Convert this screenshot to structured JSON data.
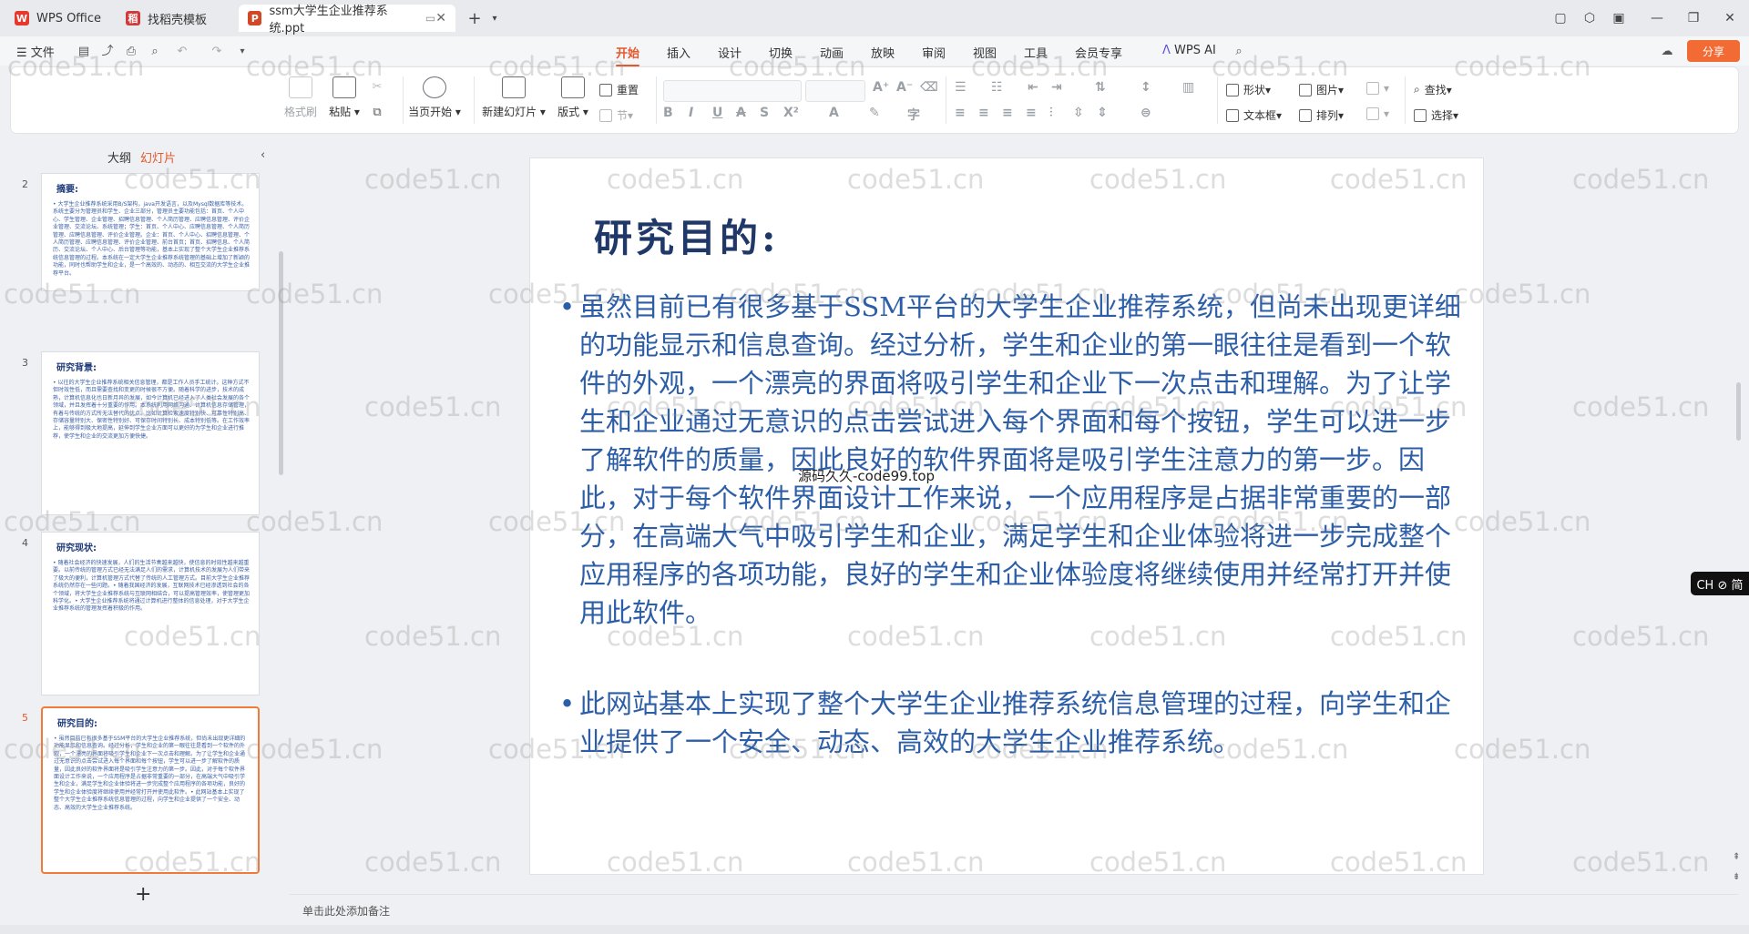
{
  "tabs": [
    {
      "label": "WPS Office",
      "icon": "wps-logo-icon",
      "color": "#e8372c"
    },
    {
      "label": "找稻壳模板",
      "icon": "docer-icon",
      "color": "#d13a3a"
    },
    {
      "label": "ssm大学生企业推荐系统.ppt",
      "icon": "ppt-icon",
      "color": "#d24726"
    }
  ],
  "menu": {
    "file": "文件",
    "ribbon_tabs": [
      "开始",
      "插入",
      "设计",
      "切换",
      "动画",
      "放映",
      "审阅",
      "视图",
      "工具",
      "会员专享"
    ],
    "active_tab": "开始",
    "wps_ai": "WPS AI",
    "share": "分享"
  },
  "ribbon": {
    "format_painter": "格式刷",
    "paste": "粘贴",
    "play_from_current": "当页开始",
    "new_slide": "新建幻灯片",
    "layout": "版式",
    "reset": "重置",
    "section": "节",
    "shape": "形状",
    "picture": "图片",
    "textbox": "文本框",
    "arrange": "排列",
    "find": "查找",
    "select": "选择"
  },
  "pane": {
    "outline_tab": "大纲",
    "slides_tab": "幻灯片",
    "active": "幻灯片"
  },
  "thumbnails": [
    {
      "num": "2",
      "title": "摘要:",
      "body": "• 大学生企业推荐系统采用B/S架构，java开发语言，以及Mysql数据库等技术。系统主要分为管理员和学生、企业三部分，管理员主要功能包括：首页、个人中心、学生管理、企业管理、招聘信息管理、个人简历管理、应聘信息管理、评价企业管理、交流论坛、系统管理；学生：首页、个人中心、应聘信息管理、个人简历管理、应聘信息管理、评价企业管理。企业：首页、个人中心、招聘信息管理、个人简历管理、应聘信息管理、评价企业管理、前台首页；首页、招聘信息、个人简历、交流论坛、个人中心、后台管理等功能，基本上实现了整个大学生企业推荐系统信息管理的过程。本系统在一定大学生企业推荐系统管理的基础上增加了新颖的功能，同时也帮助学生和企业，是一个高效的、动态的、相互交流的大学生企业推荐平台。"
    },
    {
      "num": "3",
      "title": "研究背景:",
      "body": "• 以往的大学生企业推荐系统相关信息管理，都是工作人员手工统计。这种方式不但时效性低，而且需要查找和变更的时候很不方便。随着科学的进步，技术的成熟，计算机信息化也日新月异的发展，如今计算机已经进入了人类社会发展的各个领域，并且发挥着十分重要的作用。本系统利用网络沟通、计算机信息存储管理，有着与传统的方式所无法替代的优点。比如计算检索速度特别快、可靠性特别高、存储容量特别大、保密性特别好、可保存时间特别长、成本特别低等。在工作效率上，能够得到极大地提高，延伸到学生企业方面可以更好的为学生和企业进行推荐，使学生和企业的交流更加方便快捷。"
    },
    {
      "num": "4",
      "title": "研究现状:",
      "body": "• 随着社会经济的快速发展，人们的生活节奏越来越快，使信息的时效性越来越重要。以前传统的管理方式已经无法满足人们的需求，计算机技术的发展为人们带来了极大的便利，计算机管理方式代替了传统的人工管理方式。目前大学生企业推荐系统仍然存在一些问题。• 随着我国经济的发展，互联网技术已经渗透到社会的各个领域，将大学生企业推荐系统与互联网相结合，可以提高管理效率，使管理更加科学化。• 大学生企业推荐系统将通过计算机进行整体的信息处理，对于大学生企业推荐系统的管理发挥着积极的作用。"
    },
    {
      "num": "5",
      "title": "研究目的:",
      "body": "• 虽然目前已有很多基于SSM平台的大学生企业推荐系统，但尚未出现更详细的功能显示和信息查询。经过分析，学生和企业的第一眼往往是看到一个软件的外观，一个漂亮的界面将吸引学生和企业下一次点击和理解。为了让学生和企业通过无意识的点击尝试进入每个界面和每个按钮，学生可以进一步了解软件的质量，因此良好的软件界面将是吸引学生注意力的第一步。因此，对于每个软件界面设计工作来说，一个应用程序是占据非常重要的一部分，在高端大气中吸引学生和企业，满足学生和企业体验将进一步完成整个应用程序的各项功能，良好的学生和企业体验度将继续使用并经常打开并使用此软件。• 此网站基本上实现了整个大学生企业推荐系统信息管理的过程，向学生和企业提供了一个安全、动态、高效的大学生企业推荐系统。"
    }
  ],
  "slide": {
    "title": "研究目的:",
    "bullets": [
      "虽然目前已有很多基于SSM平台的大学生企业推荐系统，但尚未出现更详细的功能显示和信息查询。经过分析，学生和企业的第一眼往往是看到一个软件的外观，一个漂亮的界面将吸引学生和企业下一次点击和理解。为了让学生和企业通过无意识的点击尝试进入每个界面和每个按钮，学生可以进一步了解软件的质量，因此良好的软件界面将是吸引学生注意力的第一步。因此，对于每个软件界面设计工作来说，一个应用程序是占据非常重要的一部分，在高端大气中吸引学生和企业，满足学生和企业体验将进一步完成整个应用程序的各项功能，良好的学生和企业体验度将继续使用并经常打开并使用此软件。",
      "此网站基本上实现了整个大学生企业推荐系统信息管理的过程，向学生和企业提供了一个安全、动态、高效的大学生企业推荐系统。"
    ],
    "overlay": "源码久久-code99.top"
  },
  "watermark": "code51.cn",
  "notes_placeholder": "单击此处添加备注",
  "ime": "CH ⊘ 简",
  "accent": "#e5582b"
}
